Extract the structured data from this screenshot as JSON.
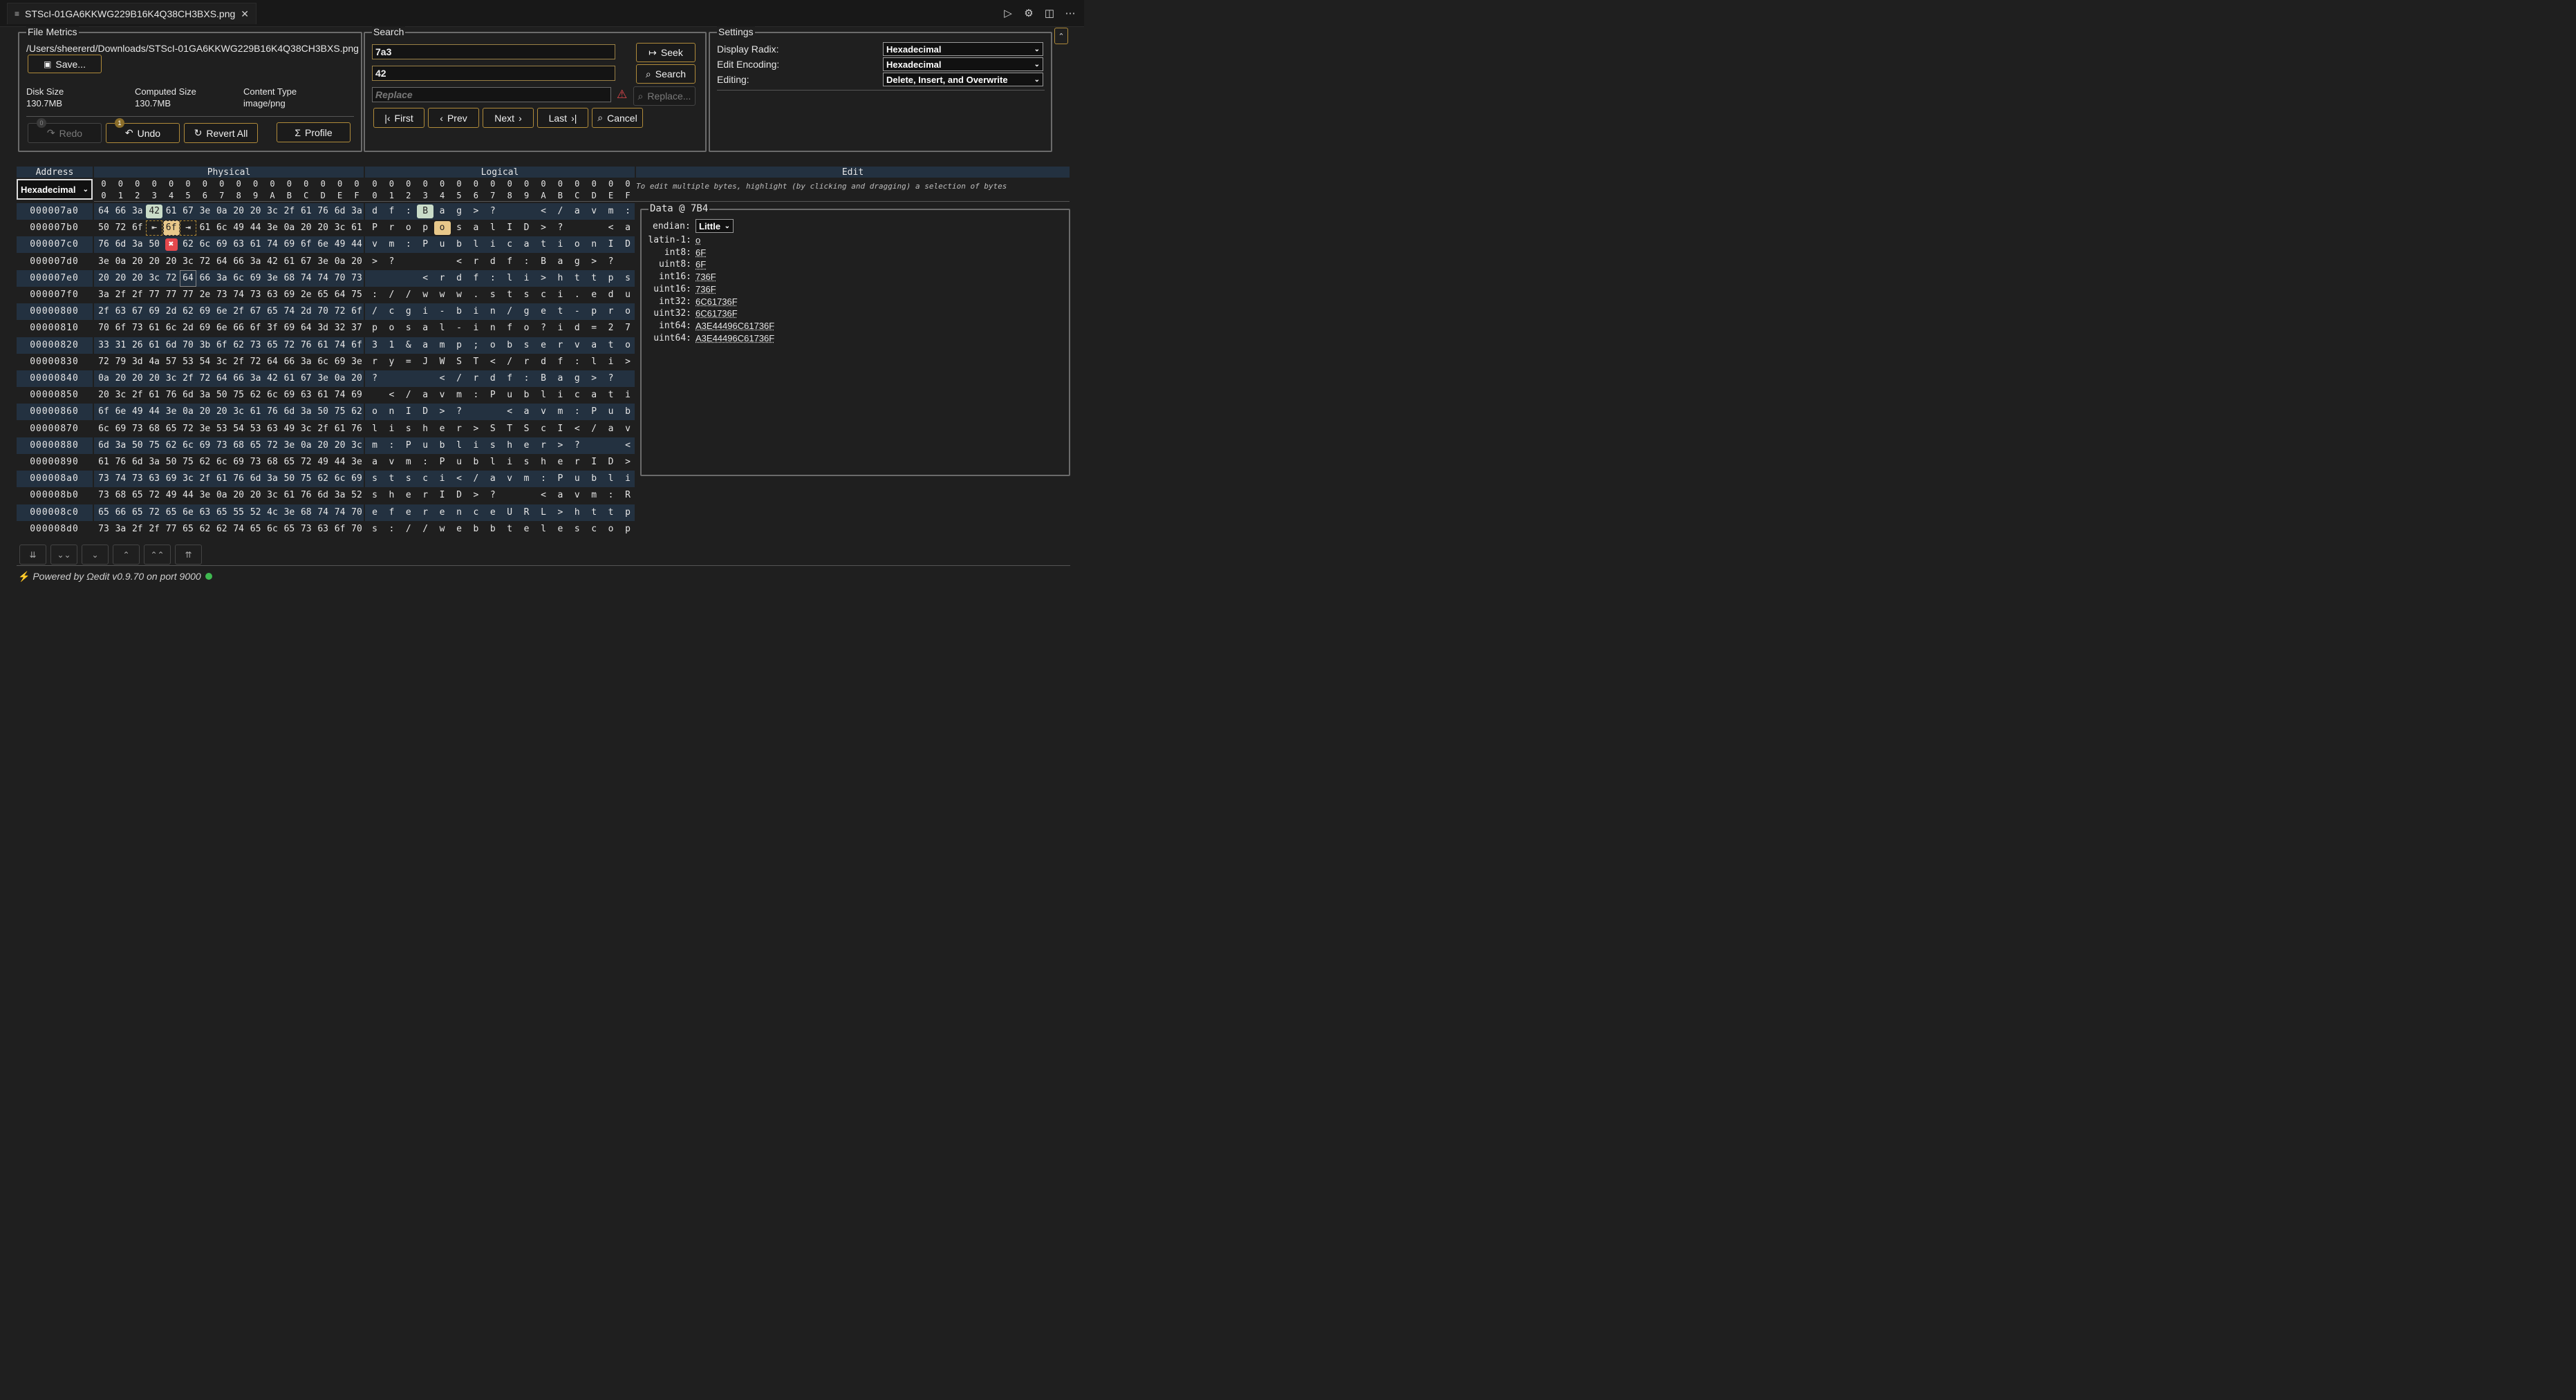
{
  "tab": {
    "title": "STScI-01GA6KKWG229B16K4Q38CH3BXS.png",
    "close": "✕"
  },
  "tab_actions": [
    "▷",
    "⚙",
    "◫",
    "⋯"
  ],
  "file_metrics": {
    "legend": "File Metrics",
    "path": "/Users/sheererd/Downloads/STScI-01GA6KKWG229B16K4Q38CH3BXS.png",
    "save_label": "Save...",
    "disk_size_label": "Disk Size",
    "disk_size": "130.7MB",
    "computed_size_label": "Computed Size",
    "computed_size": "130.7MB",
    "content_type_label": "Content Type",
    "content_type": "image/png",
    "redo_label": "Redo",
    "redo_count": "0",
    "undo_label": "Undo",
    "undo_count": "1",
    "revert_label": "Revert All",
    "profile_label": "Profile"
  },
  "search": {
    "legend": "Search",
    "seek_value": "7a3",
    "search_value": "42",
    "replace_placeholder": "Replace",
    "seek_label": "Seek",
    "search_label": "Search",
    "replace_label": "Replace...",
    "first_label": "First",
    "prev_label": "Prev",
    "next_label": "Next",
    "last_label": "Last",
    "cancel_label": "Cancel"
  },
  "settings": {
    "legend": "Settings",
    "display_radix_label": "Display Radix:",
    "display_radix": "Hexadecimal",
    "edit_encoding_label": "Edit Encoding:",
    "edit_encoding": "Hexadecimal",
    "editing_label": "Editing:",
    "editing": "Delete, Insert, and Overwrite"
  },
  "grid": {
    "address_header": "Address",
    "physical_header": "Physical",
    "logical_header": "Logical",
    "edit_header": "Edit",
    "address_radix": "Hexadecimal",
    "col_top": [
      "0",
      "0",
      "0",
      "0",
      "0",
      "0",
      "0",
      "0",
      "0",
      "0",
      "0",
      "0",
      "0",
      "0",
      "0",
      "0"
    ],
    "col_bottom": [
      "0",
      "1",
      "2",
      "3",
      "4",
      "5",
      "6",
      "7",
      "8",
      "9",
      "A",
      "B",
      "C",
      "D",
      "E",
      "F"
    ],
    "edit_hint": "To edit multiple bytes, highlight (by clicking and dragging) a selection of bytes",
    "rows": [
      {
        "addr": "000007a0",
        "hex": [
          "64",
          "66",
          "3a",
          "42",
          "61",
          "67",
          "3e",
          "0a",
          "20",
          "20",
          "3c",
          "2f",
          "61",
          "76",
          "6d",
          "3a"
        ],
        "txt": [
          "d",
          "f",
          ":",
          "B",
          "a",
          "g",
          ">",
          "?",
          " ",
          " ",
          "<",
          "/",
          "a",
          "v",
          "m",
          ":"
        ]
      },
      {
        "addr": "000007b0",
        "hex": [
          "50",
          "72",
          "6f",
          "⇤",
          "6f",
          "⇥",
          "61",
          "6c",
          "49",
          "44",
          "3e",
          "0a",
          "20",
          "20",
          "3c",
          "61"
        ],
        "txt": [
          "P",
          "r",
          "o",
          "p",
          "o",
          "s",
          "a",
          "l",
          "I",
          "D",
          ">",
          "?",
          " ",
          " ",
          "<",
          "a"
        ]
      },
      {
        "addr": "000007c0",
        "hex": [
          "76",
          "6d",
          "3a",
          "50",
          "✖",
          "62",
          "6c",
          "69",
          "63",
          "61",
          "74",
          "69",
          "6f",
          "6e",
          "49",
          "44"
        ],
        "txt": [
          "v",
          "m",
          ":",
          "P",
          "u",
          "b",
          "l",
          "i",
          "c",
          "a",
          "t",
          "i",
          "o",
          "n",
          "I",
          "D"
        ]
      },
      {
        "addr": "000007d0",
        "hex": [
          "3e",
          "0a",
          "20",
          "20",
          "20",
          "3c",
          "72",
          "64",
          "66",
          "3a",
          "42",
          "61",
          "67",
          "3e",
          "0a",
          "20"
        ],
        "txt": [
          ">",
          "?",
          " ",
          " ",
          " ",
          "<",
          "r",
          "d",
          "f",
          ":",
          "B",
          "a",
          "g",
          ">",
          "?",
          " "
        ]
      },
      {
        "addr": "000007e0",
        "hex": [
          "20",
          "20",
          "20",
          "3c",
          "72",
          "64",
          "66",
          "3a",
          "6c",
          "69",
          "3e",
          "68",
          "74",
          "74",
          "70",
          "73"
        ],
        "txt": [
          " ",
          " ",
          " ",
          "<",
          "r",
          "d",
          "f",
          ":",
          "l",
          "i",
          ">",
          "h",
          "t",
          "t",
          "p",
          "s"
        ]
      },
      {
        "addr": "000007f0",
        "hex": [
          "3a",
          "2f",
          "2f",
          "77",
          "77",
          "77",
          "2e",
          "73",
          "74",
          "73",
          "63",
          "69",
          "2e",
          "65",
          "64",
          "75"
        ],
        "txt": [
          ":",
          "/",
          "/",
          "w",
          "w",
          "w",
          ".",
          "s",
          "t",
          "s",
          "c",
          "i",
          ".",
          "e",
          "d",
          "u"
        ]
      },
      {
        "addr": "00000800",
        "hex": [
          "2f",
          "63",
          "67",
          "69",
          "2d",
          "62",
          "69",
          "6e",
          "2f",
          "67",
          "65",
          "74",
          "2d",
          "70",
          "72",
          "6f"
        ],
        "txt": [
          "/",
          "c",
          "g",
          "i",
          "-",
          "b",
          "i",
          "n",
          "/",
          "g",
          "e",
          "t",
          "-",
          "p",
          "r",
          "o"
        ]
      },
      {
        "addr": "00000810",
        "hex": [
          "70",
          "6f",
          "73",
          "61",
          "6c",
          "2d",
          "69",
          "6e",
          "66",
          "6f",
          "3f",
          "69",
          "64",
          "3d",
          "32",
          "37"
        ],
        "txt": [
          "p",
          "o",
          "s",
          "a",
          "l",
          "-",
          "i",
          "n",
          "f",
          "o",
          "?",
          "i",
          "d",
          "=",
          "2",
          "7"
        ]
      },
      {
        "addr": "00000820",
        "hex": [
          "33",
          "31",
          "26",
          "61",
          "6d",
          "70",
          "3b",
          "6f",
          "62",
          "73",
          "65",
          "72",
          "76",
          "61",
          "74",
          "6f"
        ],
        "txt": [
          "3",
          "1",
          "&",
          "a",
          "m",
          "p",
          ";",
          "o",
          "b",
          "s",
          "e",
          "r",
          "v",
          "a",
          "t",
          "o"
        ]
      },
      {
        "addr": "00000830",
        "hex": [
          "72",
          "79",
          "3d",
          "4a",
          "57",
          "53",
          "54",
          "3c",
          "2f",
          "72",
          "64",
          "66",
          "3a",
          "6c",
          "69",
          "3e"
        ],
        "txt": [
          "r",
          "y",
          "=",
          "J",
          "W",
          "S",
          "T",
          "<",
          "/",
          "r",
          "d",
          "f",
          ":",
          "l",
          "i",
          ">"
        ]
      },
      {
        "addr": "00000840",
        "hex": [
          "0a",
          "20",
          "20",
          "20",
          "3c",
          "2f",
          "72",
          "64",
          "66",
          "3a",
          "42",
          "61",
          "67",
          "3e",
          "0a",
          "20"
        ],
        "txt": [
          "?",
          " ",
          " ",
          " ",
          "<",
          "/",
          "r",
          "d",
          "f",
          ":",
          "B",
          "a",
          "g",
          ">",
          "?",
          " "
        ]
      },
      {
        "addr": "00000850",
        "hex": [
          "20",
          "3c",
          "2f",
          "61",
          "76",
          "6d",
          "3a",
          "50",
          "75",
          "62",
          "6c",
          "69",
          "63",
          "61",
          "74",
          "69"
        ],
        "txt": [
          " ",
          "<",
          "/",
          "a",
          "v",
          "m",
          ":",
          "P",
          "u",
          "b",
          "l",
          "i",
          "c",
          "a",
          "t",
          "i"
        ]
      },
      {
        "addr": "00000860",
        "hex": [
          "6f",
          "6e",
          "49",
          "44",
          "3e",
          "0a",
          "20",
          "20",
          "3c",
          "61",
          "76",
          "6d",
          "3a",
          "50",
          "75",
          "62"
        ],
        "txt": [
          "o",
          "n",
          "I",
          "D",
          ">",
          "?",
          " ",
          " ",
          "<",
          "a",
          "v",
          "m",
          ":",
          "P",
          "u",
          "b"
        ]
      },
      {
        "addr": "00000870",
        "hex": [
          "6c",
          "69",
          "73",
          "68",
          "65",
          "72",
          "3e",
          "53",
          "54",
          "53",
          "63",
          "49",
          "3c",
          "2f",
          "61",
          "76"
        ],
        "txt": [
          "l",
          "i",
          "s",
          "h",
          "e",
          "r",
          ">",
          "S",
          "T",
          "S",
          "c",
          "I",
          "<",
          "/",
          "a",
          "v"
        ]
      },
      {
        "addr": "00000880",
        "hex": [
          "6d",
          "3a",
          "50",
          "75",
          "62",
          "6c",
          "69",
          "73",
          "68",
          "65",
          "72",
          "3e",
          "0a",
          "20",
          "20",
          "3c"
        ],
        "txt": [
          "m",
          ":",
          "P",
          "u",
          "b",
          "l",
          "i",
          "s",
          "h",
          "e",
          "r",
          ">",
          "?",
          " ",
          " ",
          "<"
        ]
      },
      {
        "addr": "00000890",
        "hex": [
          "61",
          "76",
          "6d",
          "3a",
          "50",
          "75",
          "62",
          "6c",
          "69",
          "73",
          "68",
          "65",
          "72",
          "49",
          "44",
          "3e"
        ],
        "txt": [
          "a",
          "v",
          "m",
          ":",
          "P",
          "u",
          "b",
          "l",
          "i",
          "s",
          "h",
          "e",
          "r",
          "I",
          "D",
          ">"
        ]
      },
      {
        "addr": "000008a0",
        "hex": [
          "73",
          "74",
          "73",
          "63",
          "69",
          "3c",
          "2f",
          "61",
          "76",
          "6d",
          "3a",
          "50",
          "75",
          "62",
          "6c",
          "69"
        ],
        "txt": [
          "s",
          "t",
          "s",
          "c",
          "i",
          "<",
          "/",
          "a",
          "v",
          "m",
          ":",
          "P",
          "u",
          "b",
          "l",
          "i"
        ]
      },
      {
        "addr": "000008b0",
        "hex": [
          "73",
          "68",
          "65",
          "72",
          "49",
          "44",
          "3e",
          "0a",
          "20",
          "20",
          "3c",
          "61",
          "76",
          "6d",
          "3a",
          "52"
        ],
        "txt": [
          "s",
          "h",
          "e",
          "r",
          "I",
          "D",
          ">",
          "?",
          " ",
          " ",
          "<",
          "a",
          "v",
          "m",
          ":",
          "R"
        ]
      },
      {
        "addr": "000008c0",
        "hex": [
          "65",
          "66",
          "65",
          "72",
          "65",
          "6e",
          "63",
          "65",
          "55",
          "52",
          "4c",
          "3e",
          "68",
          "74",
          "74",
          "70"
        ],
        "txt": [
          "e",
          "f",
          "e",
          "r",
          "e",
          "n",
          "c",
          "e",
          "U",
          "R",
          "L",
          ">",
          "h",
          "t",
          "t",
          "p"
        ]
      },
      {
        "addr": "000008d0",
        "hex": [
          "73",
          "3a",
          "2f",
          "2f",
          "77",
          "65",
          "62",
          "62",
          "74",
          "65",
          "6c",
          "65",
          "73",
          "63",
          "6f",
          "70"
        ],
        "txt": [
          "s",
          ":",
          "/",
          "/",
          "w",
          "e",
          "b",
          "b",
          "t",
          "e",
          "l",
          "e",
          "s",
          "c",
          "o",
          "p"
        ]
      }
    ]
  },
  "data_panel": {
    "legend": "Data @ 7B4",
    "endian_label": "endian:",
    "endian": "Little",
    "fields": [
      {
        "label": "latin-1:",
        "value": "o"
      },
      {
        "label": "int8:",
        "value": "6F"
      },
      {
        "label": "uint8:",
        "value": "6F"
      },
      {
        "label": "int16:",
        "value": "736F"
      },
      {
        "label": "uint16:",
        "value": "736F"
      },
      {
        "label": "int32:",
        "value": "6C61736F"
      },
      {
        "label": "uint32:",
        "value": "6C61736F"
      },
      {
        "label": "int64:",
        "value": "A3E44496C61736F"
      },
      {
        "label": "uint64:",
        "value": "A3E44496C61736F"
      }
    ]
  },
  "scroll_buttons": [
    "⇊",
    "⌄⌄",
    "⌄",
    "⌃",
    "⌃⌃",
    "⇈"
  ],
  "footer": {
    "text": "Powered by Ωedit v0.9.70 on port 9000"
  },
  "colors": {
    "accent": "#b08b3a",
    "row_alt": "#233140",
    "status": "#3fb950"
  }
}
